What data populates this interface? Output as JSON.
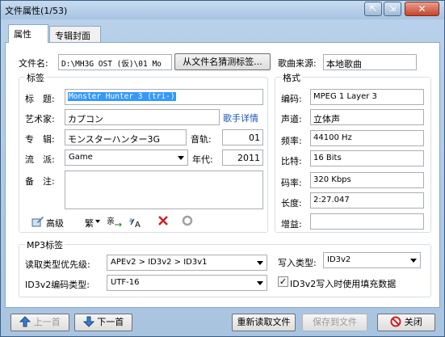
{
  "window": {
    "title": "文件属性(1/53)"
  },
  "titlebar_buttons": {
    "a": "⇱",
    "b": "⇲",
    "close": "✕"
  },
  "tabs": [
    {
      "label": "属性"
    },
    {
      "label": "专辑封面"
    }
  ],
  "file": {
    "name_label": "文件名:",
    "name_value": "D:\\MH3G OST (仮)\\01 Mo",
    "guess_button": "从文件名猜测标签...",
    "source_label": "歌曲来源:",
    "source_value": "本地歌曲"
  },
  "tag_group": {
    "title": "标签",
    "title_label": "标　题:",
    "title_value": "Monster Hunter 3 (tri-)",
    "artist_label": "艺术家:",
    "artist_value": "カプコン",
    "artist_link": "歌手详情",
    "album_label": "专　辑:",
    "album_value": "モンスターハンター3G",
    "track_label": "音轨:",
    "track_value": "01",
    "genre_label": "流　派:",
    "genre_value": "Game",
    "year_label": "年代:",
    "year_value": "2011",
    "comment_label": "备　注:",
    "comment_value": ""
  },
  "toolbar": {
    "advanced_label": "高级",
    "traditional_label": "繁",
    "edit_icon": "pencil-icon",
    "convert_icon": "convert-icon",
    "case_icon": "case-icon",
    "clear_icon": "clear-icon",
    "undo_icon": "undo-icon"
  },
  "format_group": {
    "title": "格式",
    "encoding_label": "编码:",
    "encoding_value": "MPEG 1 Layer 3",
    "channel_label": "声道:",
    "channel_value": "立体声",
    "freq_label": "频率:",
    "freq_value": "44100 Hz",
    "bits_label": "比特:",
    "bits_value": "16 Bits",
    "bitrate_label": "码率:",
    "bitrate_value": "320 Kbps",
    "length_label": "长度:",
    "length_value": "2:27.047",
    "gain_label": "增益:",
    "gain_value": ""
  },
  "mp3_group": {
    "title": "MP3标签",
    "priority_label": "读取类型优先级:",
    "priority_value": "APEv2 > ID3v2 > ID3v1",
    "write_label": "写入类型:",
    "write_value": "ID3v2",
    "encoding_label": "ID3v2编码类型:",
    "encoding_value": "UTF-16",
    "padding_checkbox_label": "ID3v2写入时使用填充数据",
    "padding_checked": true
  },
  "bottom": {
    "prev_label": "上一首",
    "next_label": "下一首",
    "reload_label": "重新读取文件",
    "save_label": "保存到文件",
    "close_label": "关闭"
  }
}
